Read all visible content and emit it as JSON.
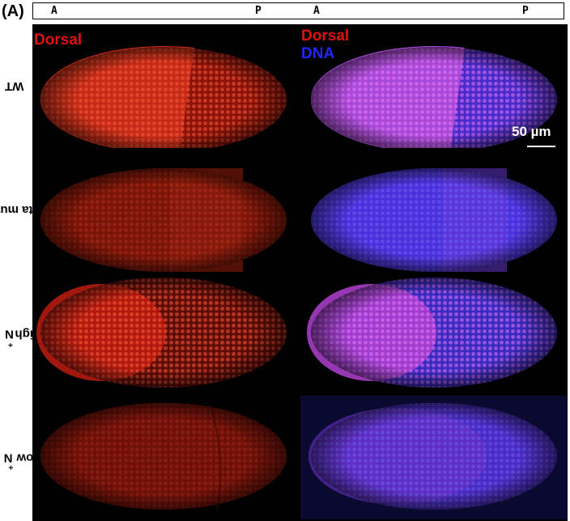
{
  "figure": {
    "panel_label": "(A)",
    "axis": {
      "anterior_left": "A",
      "posterior_left": "P",
      "anterior_right": "A",
      "posterior_right": "P"
    },
    "channels": {
      "red_label": "Dorsal",
      "blue_label": "DNA",
      "red_color": "#e01010",
      "blue_color": "#2424ff"
    },
    "rows": [
      {
        "label": "WT",
        "sup": "",
        "label_rest": ""
      },
      {
        "label": "Delta mutant",
        "sup": "",
        "label_rest": ""
      },
      {
        "label": "N",
        "sup": "+",
        "label_rest": " High"
      },
      {
        "label": "N",
        "sup": "+",
        "label_rest": " Low"
      }
    ],
    "scale_bar": {
      "label": "50 µm"
    }
  }
}
